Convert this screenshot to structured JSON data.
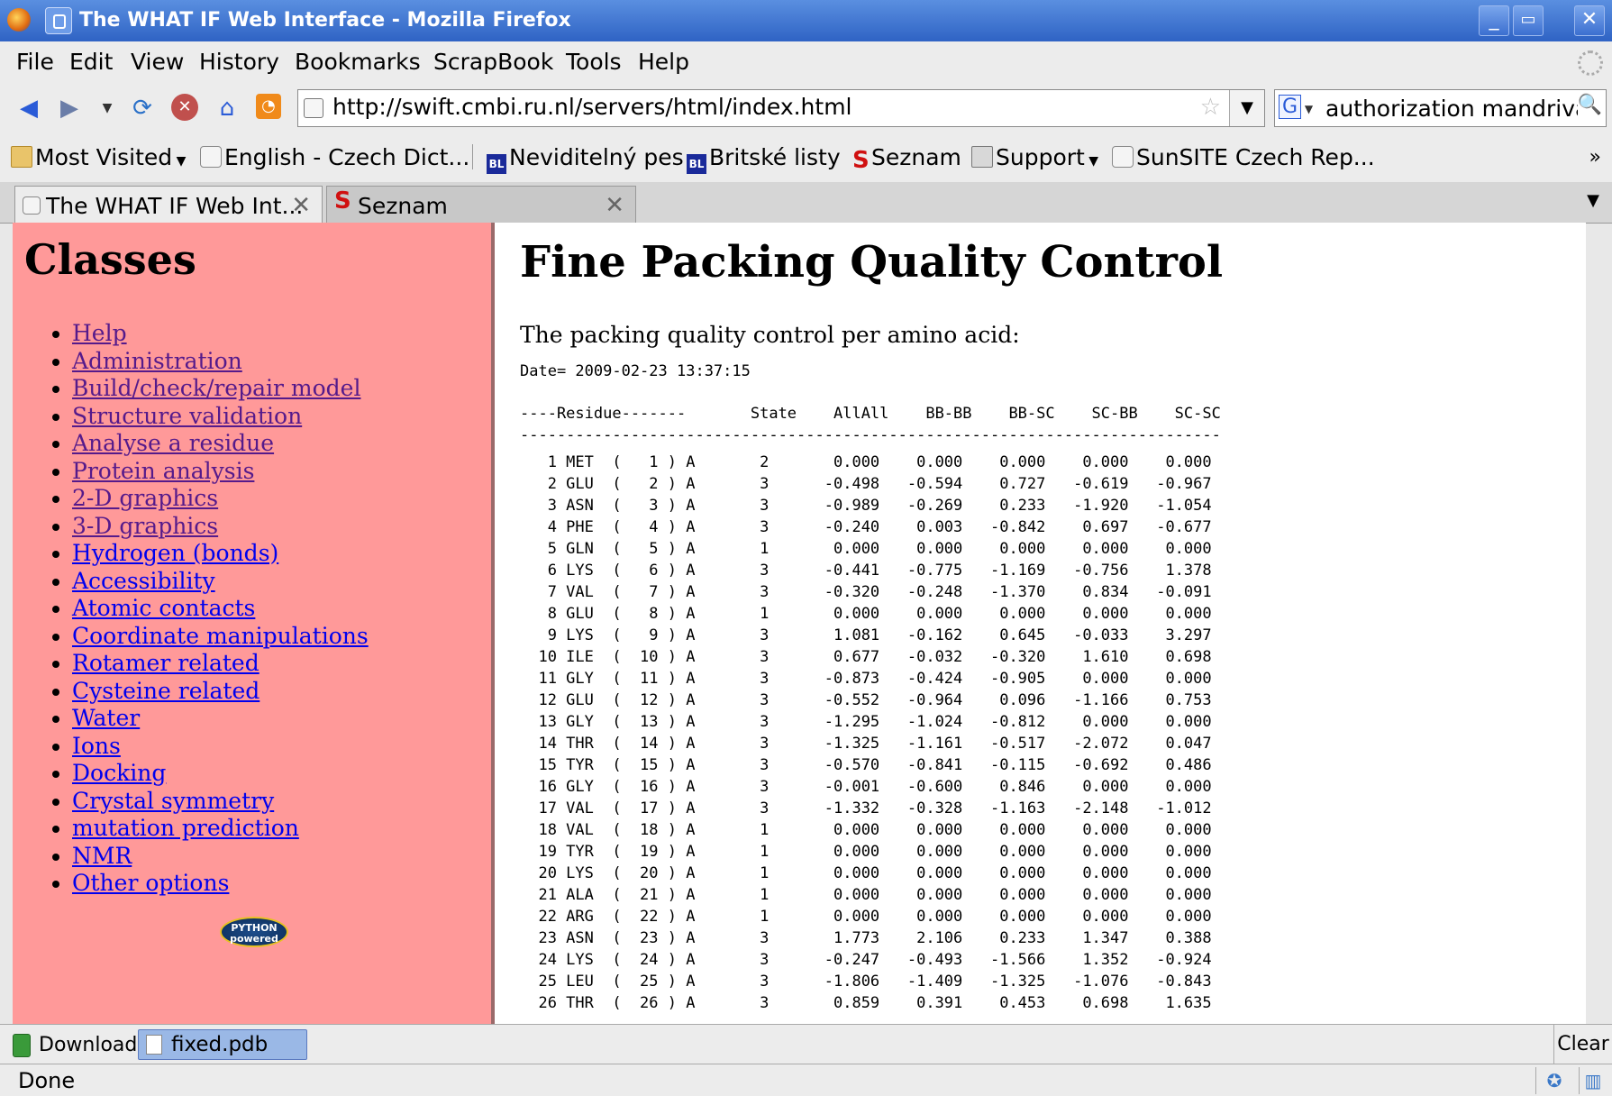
{
  "window": {
    "title": "The WHAT IF Web Interface - Mozilla Firefox",
    "controls": [
      "_",
      "▭",
      "✕"
    ]
  },
  "menu": [
    "File",
    "Edit",
    "View",
    "History",
    "Bookmarks",
    "ScrapBook",
    "Tools",
    "Help"
  ],
  "nav": {
    "url": "http://swift.cmbi.ru.nl/servers/html/index.html",
    "search_engine": "G",
    "search_value": "authorization mandriva"
  },
  "bookmarks": [
    {
      "label": "Most Visited",
      "icon": "folder",
      "dropdown": true
    },
    {
      "label": "English - Czech Dict...",
      "icon": "page"
    },
    {
      "label": "Neviditelný pes",
      "icon": "bl"
    },
    {
      "label": "Britské listy",
      "icon": "bl"
    },
    {
      "label": "Seznam",
      "icon": "sez"
    },
    {
      "label": "Support",
      "icon": "folder",
      "dropdown": true
    },
    {
      "label": "SunSITE Czech Rep...",
      "icon": "page"
    }
  ],
  "tabs": [
    {
      "label": "The WHAT IF Web Int...",
      "active": true
    },
    {
      "label": "Seznam",
      "active": false
    }
  ],
  "sidebar": {
    "title": "Classes",
    "links": [
      {
        "label": "Help",
        "visited": true
      },
      {
        "label": "Administration",
        "visited": true
      },
      {
        "label": "Build/check/repair model",
        "visited": true
      },
      {
        "label": "Structure validation",
        "visited": true
      },
      {
        "label": "Analyse a residue",
        "visited": true
      },
      {
        "label": "Protein analysis",
        "visited": true
      },
      {
        "label": "2-D graphics",
        "visited": true
      },
      {
        "label": "3-D graphics",
        "visited": true
      },
      {
        "label": "Hydrogen (bonds)",
        "visited": false
      },
      {
        "label": "Accessibility",
        "visited": false
      },
      {
        "label": "Atomic contacts",
        "visited": false
      },
      {
        "label": "Coordinate manipulations",
        "visited": false
      },
      {
        "label": "Rotamer related",
        "visited": false
      },
      {
        "label": "Cysteine related",
        "visited": false
      },
      {
        "label": "Water",
        "visited": false
      },
      {
        "label": "Ions",
        "visited": false
      },
      {
        "label": "Docking",
        "visited": false
      },
      {
        "label": "Crystal symmetry",
        "visited": false
      },
      {
        "label": "mutation prediction",
        "visited": false
      },
      {
        "label": "NMR",
        "visited": false
      },
      {
        "label": "Other options",
        "visited": false
      }
    ],
    "badge": "PYTHON\npowered"
  },
  "main": {
    "title": "Fine Packing Quality Control",
    "intro": "The packing quality control per amino acid:",
    "date": "Date= 2009-02-23 13:37:15",
    "header": "----Residue-------       State    AllAll    BB-BB    BB-SC    SC-BB    SC-SC",
    "rule": "----------------------------------------------------------------------------",
    "rows": [
      "   1 MET  (   1 ) A       2       0.000    0.000    0.000    0.000    0.000",
      "   2 GLU  (   2 ) A       3      -0.498   -0.594    0.727   -0.619   -0.967",
      "   3 ASN  (   3 ) A       3      -0.989   -0.269    0.233   -1.920   -1.054",
      "   4 PHE  (   4 ) A       3      -0.240    0.003   -0.842    0.697   -0.677",
      "   5 GLN  (   5 ) A       1       0.000    0.000    0.000    0.000    0.000",
      "   6 LYS  (   6 ) A       3      -0.441   -0.775   -1.169   -0.756    1.378",
      "   7 VAL  (   7 ) A       3      -0.320   -0.248   -1.370    0.834   -0.091",
      "   8 GLU  (   8 ) A       1       0.000    0.000    0.000    0.000    0.000",
      "   9 LYS  (   9 ) A       3       1.081   -0.162    0.645   -0.033    3.297",
      "  10 ILE  (  10 ) A       3       0.677   -0.032   -0.320    1.610    0.698",
      "  11 GLY  (  11 ) A       3      -0.873   -0.424   -0.905    0.000    0.000",
      "  12 GLU  (  12 ) A       3      -0.552   -0.964    0.096   -1.166    0.753",
      "  13 GLY  (  13 ) A       3      -1.295   -1.024   -0.812    0.000    0.000",
      "  14 THR  (  14 ) A       3      -1.325   -1.161   -0.517   -2.072    0.047",
      "  15 TYR  (  15 ) A       3      -0.570   -0.841   -0.115   -0.692    0.486",
      "  16 GLY  (  16 ) A       3      -0.001   -0.600    0.846    0.000    0.000",
      "  17 VAL  (  17 ) A       3      -1.332   -0.328   -1.163   -2.148   -1.012",
      "  18 VAL  (  18 ) A       1       0.000    0.000    0.000    0.000    0.000",
      "  19 TYR  (  19 ) A       1       0.000    0.000    0.000    0.000    0.000",
      "  20 LYS  (  20 ) A       1       0.000    0.000    0.000    0.000    0.000",
      "  21 ALA  (  21 ) A       1       0.000    0.000    0.000    0.000    0.000",
      "  22 ARG  (  22 ) A       1       0.000    0.000    0.000    0.000    0.000",
      "  23 ASN  (  23 ) A       3       1.773    2.106    0.233    1.347    0.388",
      "  24 LYS  (  24 ) A       3      -0.247   -0.493   -1.566    1.352   -0.924",
      "  25 LEU  (  25 ) A       3      -1.806   -1.409   -1.325   -1.076   -0.843",
      "  26 THR  (  26 ) A       3       0.859    0.391    0.453    0.698    1.635"
    ]
  },
  "downloads": {
    "label": "Downloads",
    "file": "fixed.pdb",
    "clear": "Clear"
  },
  "status": {
    "text": "Done"
  }
}
